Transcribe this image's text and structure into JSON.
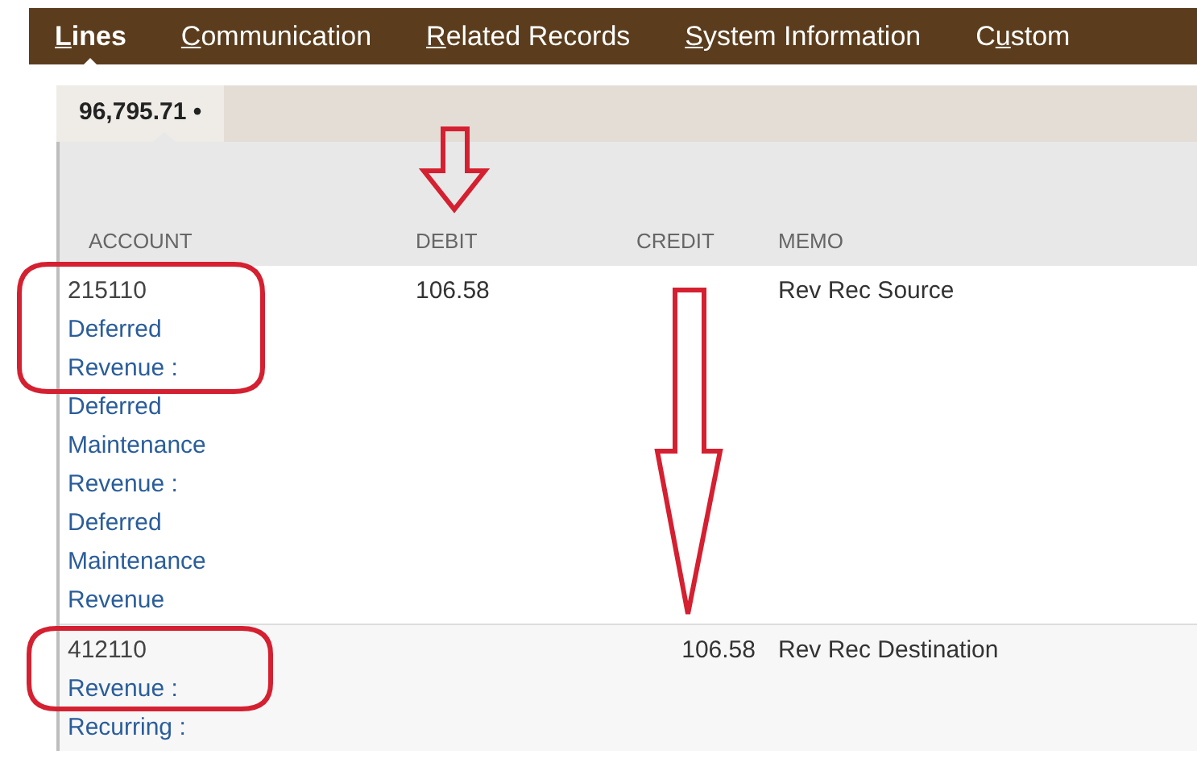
{
  "tabs": [
    {
      "hotkey": "L",
      "suffix": "ines",
      "selected": true
    },
    {
      "hotkey": "C",
      "suffix": "ommunication",
      "selected": false
    },
    {
      "hotkey": "R",
      "suffix": "elated Records",
      "selected": false
    },
    {
      "hotkey": "S",
      "suffix": "ystem Information",
      "selected": false
    },
    {
      "prefix": "C",
      "hotkey": "u",
      "suffix": "stom",
      "selected": false
    }
  ],
  "subtabs": [
    {
      "label": "96,795.71 •",
      "selected": true
    }
  ],
  "table": {
    "columns": [
      "ACCOUNT",
      "DEBIT",
      "CREDIT",
      "MEMO"
    ],
    "rows": [
      {
        "account_number": "215110",
        "account_name": "Deferred Revenue : Deferred Maintenance Revenue : Deferred Maintenance Revenue",
        "debit": "106.58",
        "credit": "",
        "memo": "Rev Rec Source"
      },
      {
        "account_number": "412110",
        "account_name": "Revenue : Recurring :",
        "debit": "",
        "credit": "106.58",
        "memo": "Rev Rec Destination"
      }
    ]
  }
}
